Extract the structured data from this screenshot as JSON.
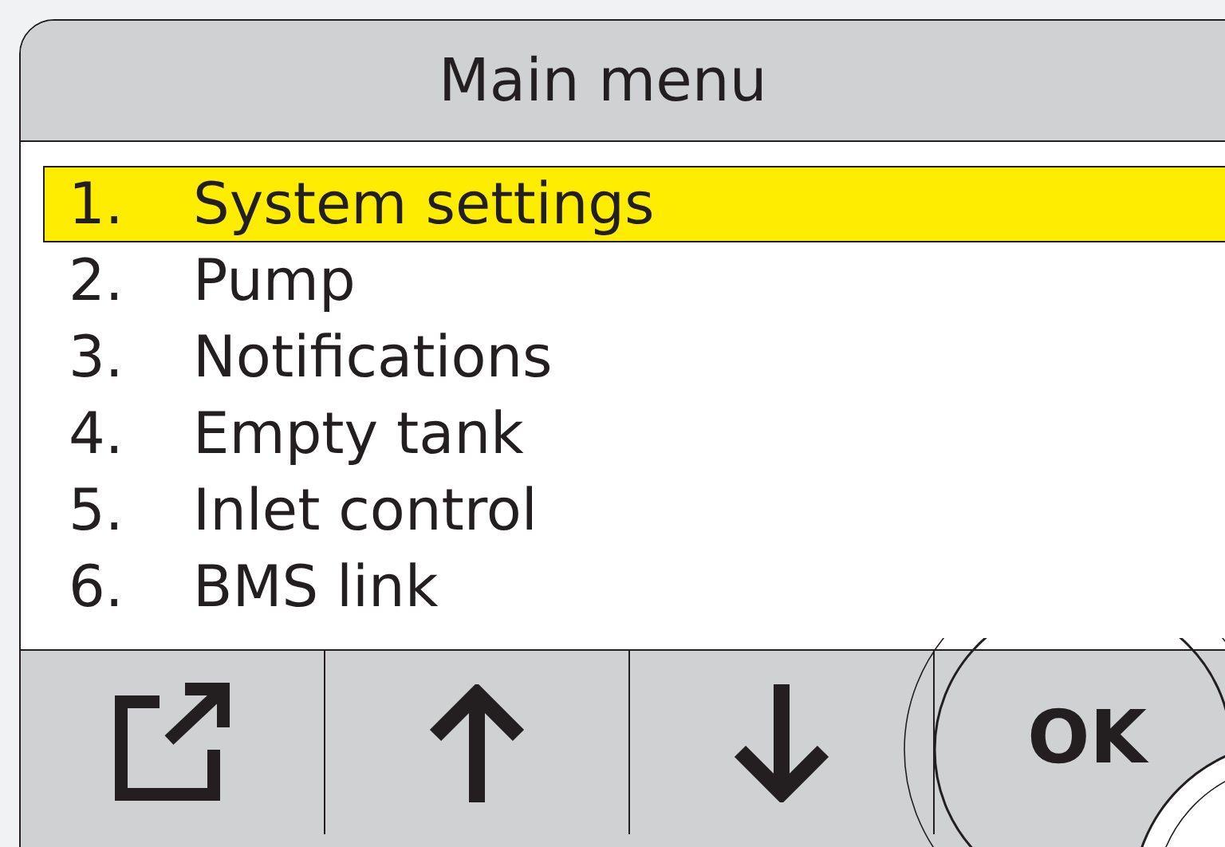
{
  "window": {
    "title": "Main menu"
  },
  "menu": {
    "items": [
      {
        "number": "1.",
        "label": "System settings",
        "selected": true
      },
      {
        "number": "2.",
        "label": "Pump",
        "selected": false
      },
      {
        "number": "3.",
        "label": "Notifications",
        "selected": false
      },
      {
        "number": "4.",
        "label": "Empty tank",
        "selected": false
      },
      {
        "number": "5.",
        "label": "Inlet control",
        "selected": false
      },
      {
        "number": "6.",
        "label": "BMS link",
        "selected": false
      }
    ]
  },
  "buttons": [
    {
      "kind": "export"
    },
    {
      "kind": "up"
    },
    {
      "kind": "down"
    },
    {
      "kind": "text",
      "label": "OK"
    }
  ]
}
